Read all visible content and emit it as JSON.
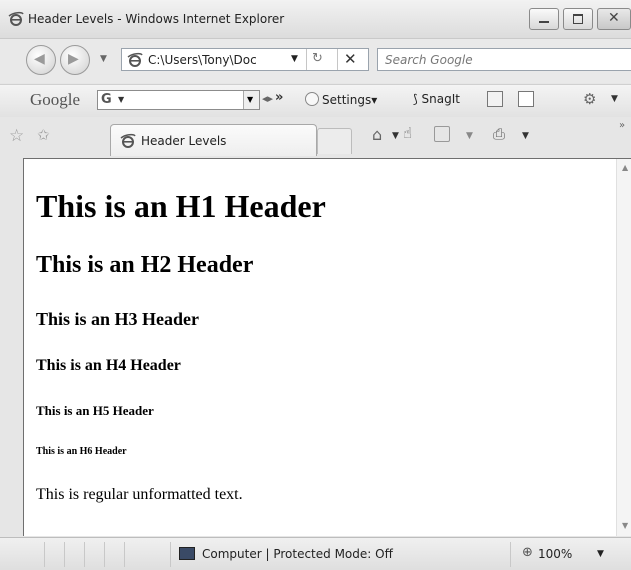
{
  "window": {
    "title": "Header Levels - Windows Internet Explorer"
  },
  "navigation": {
    "address": "C:\\Users\\Tony\\Doc",
    "search_placeholder": "Search Google"
  },
  "google_toolbar": {
    "logo": "Google",
    "search_prefix": "G",
    "settings_label": "Settings",
    "snagit_label": "SnagIt"
  },
  "tab": {
    "label": "Header Levels"
  },
  "document": {
    "h1": "This is an H1 Header",
    "h2": "This is an H2 Header",
    "h3": "This is an H3 Header",
    "h4": "This is an H4 Header",
    "h5": "This is an H5 Header",
    "h6": "This is an H6 Header",
    "paragraph": "This is regular unformatted text."
  },
  "status": {
    "zone_text": "Computer | Protected Mode: Off",
    "zoom": "100%"
  },
  "icons": [
    "ie-logo-icon",
    "minimize-icon",
    "maximize-icon",
    "close-icon",
    "back-icon",
    "forward-icon",
    "refresh-icon",
    "stop-icon",
    "favorites-star-icon",
    "add-favorites-icon",
    "home-icon",
    "research-icon",
    "feeds-icon",
    "print-icon",
    "computer-icon",
    "zoom-icon"
  ]
}
